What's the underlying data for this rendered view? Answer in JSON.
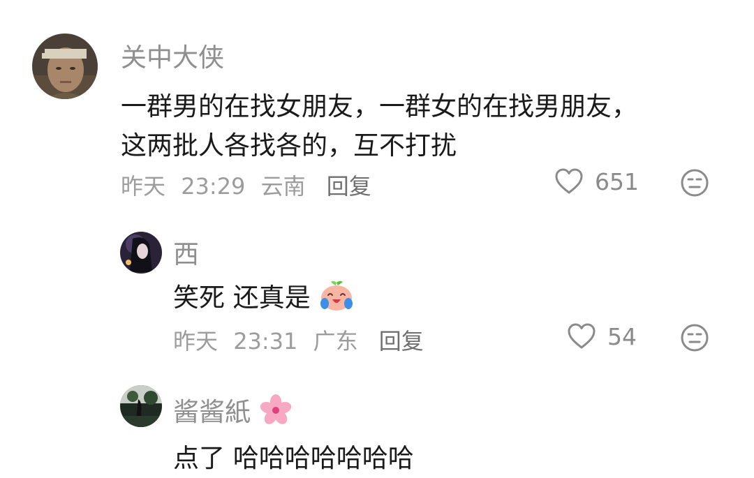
{
  "comments": [
    {
      "username": "关中大侠",
      "text_line1": "一群男的在找女朋友，一群女的在找男朋友，",
      "text_line2": "这两批人各找各的，互不打扰",
      "date": "昨天",
      "time": "23:29",
      "location": "云南",
      "reply_label": "回复",
      "likes": "651"
    },
    {
      "username": "西",
      "text": "笑死  还真是",
      "text_emoji": "crying-laughing-peach-emoji",
      "date": "昨天",
      "time": "23:31",
      "location": "广东",
      "reply_label": "回复",
      "likes": "54"
    },
    {
      "username": "酱酱紙",
      "username_emoji": "cherry-blossom-emoji",
      "text": "点了 哈哈哈哈哈哈哈"
    }
  ],
  "colors": {
    "username": "#8f8f8f",
    "text": "#1a1a1a",
    "meta": "#9c9c9c",
    "icon": "#8a8a8a"
  }
}
